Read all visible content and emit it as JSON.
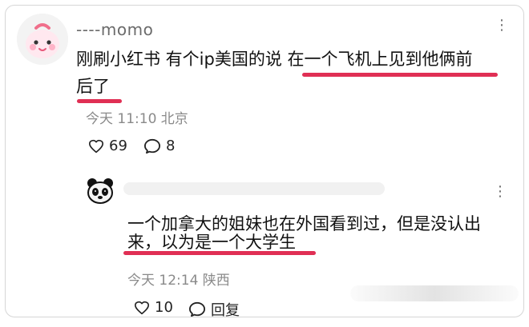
{
  "comments": [
    {
      "username": "----momo",
      "more_label": "⋮",
      "text_line_1": "刚刷小红书 有个ip美国的说 在一个飞机上见到他俩前",
      "text_line_2": "后了",
      "time_location": "今天 11:10 北京",
      "like_count": "69",
      "reply_count": "8",
      "colors": {
        "underline": "#e02f54",
        "meta": "#8a8a8a"
      },
      "icons": [
        "kawaii-avatar",
        "heart-icon",
        "comment-bubble-icon",
        "more-vertical-icon"
      ]
    },
    {
      "more_label": "⋮",
      "text_line_1": "一个加拿大的姐妹也在外国看到过，但是没认出",
      "text_line_2": "来，以为是一个大学生",
      "time_location": "今天 12:14 陕西",
      "like_count": "10",
      "reply_label": "回复",
      "colors": {
        "underline": "#e02f54",
        "meta": "#8a8a8a"
      },
      "icons": [
        "panda-avatar",
        "heart-icon",
        "comment-bubble-icon",
        "more-vertical-icon"
      ]
    }
  ]
}
